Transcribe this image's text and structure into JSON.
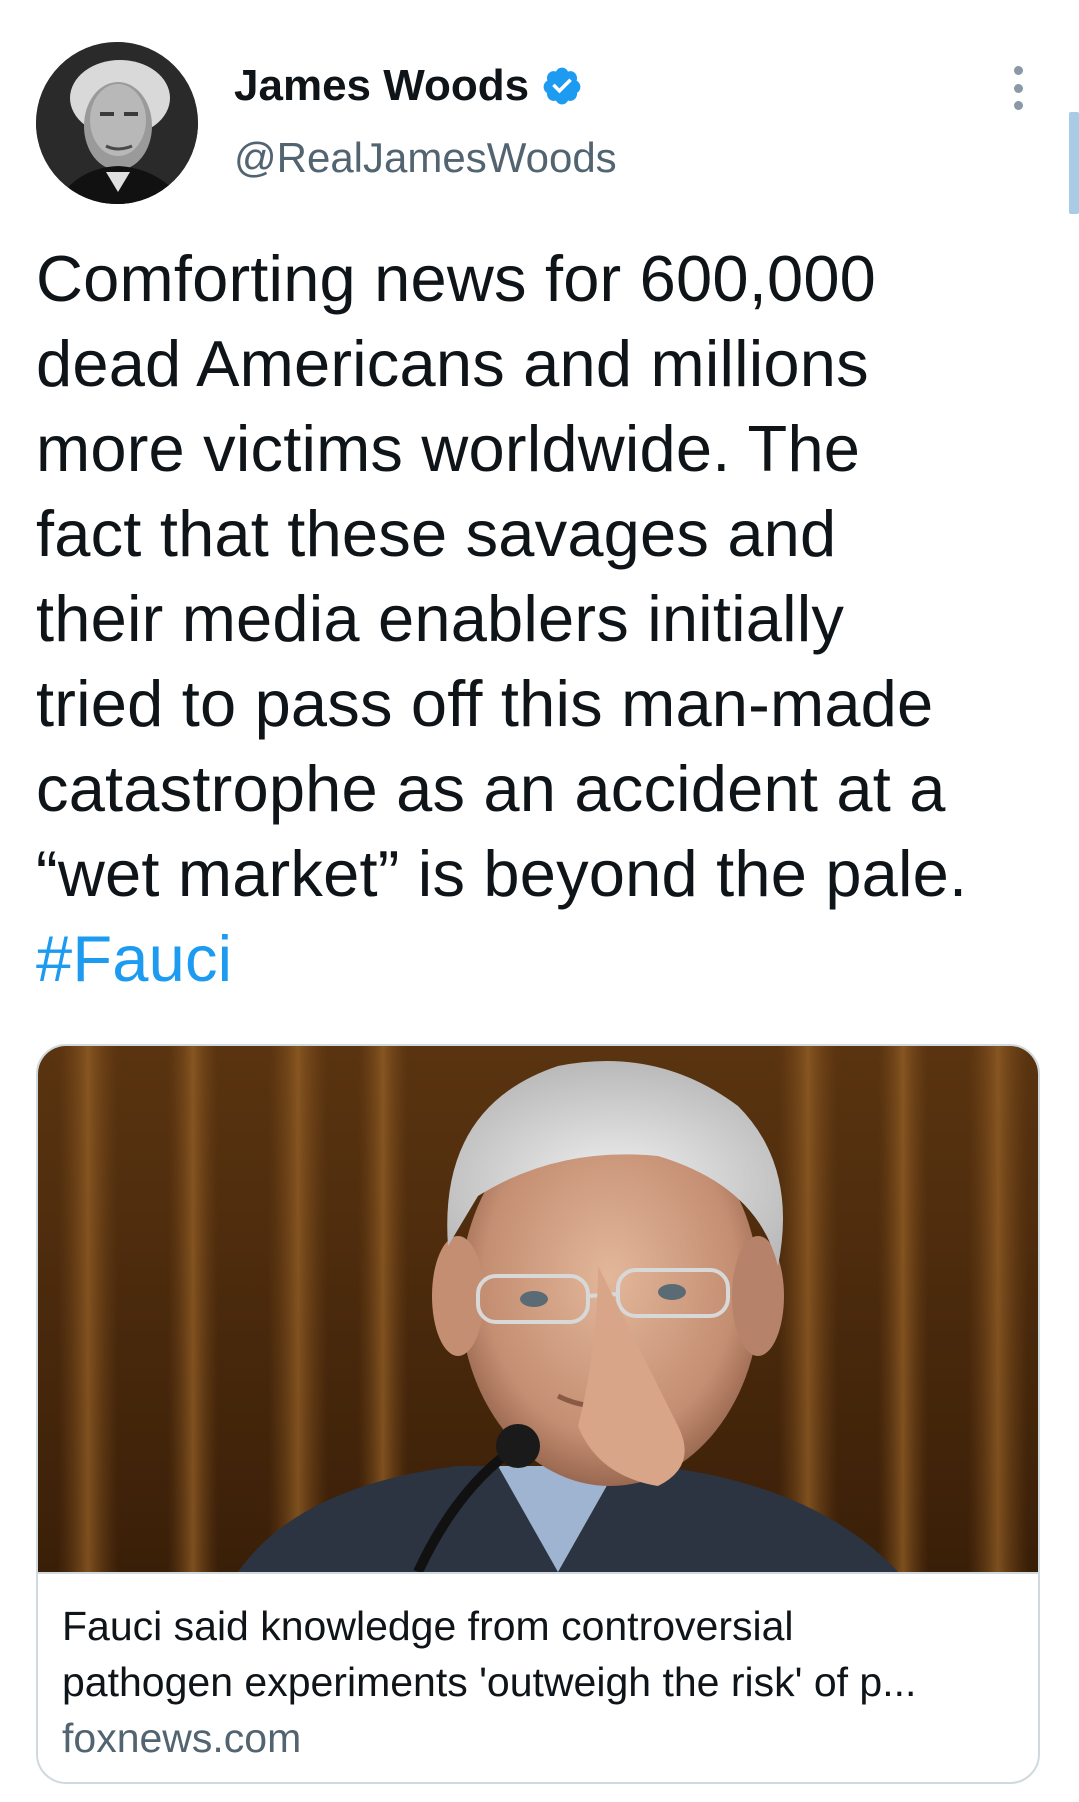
{
  "author": {
    "display_name": "James Woods",
    "handle": "@RealJamesWoods",
    "verified": true,
    "avatar_icon": "profile-photo"
  },
  "tweet": {
    "lines": [
      "Comforting news for 600,000",
      "dead Americans and millions",
      "more victims worldwide. The",
      "fact that these savages and",
      "their media enablers initially",
      "tried to pass off this man-made",
      "catastrophe as an accident at a",
      "“wet market” is beyond the pale."
    ],
    "hashtag": "#Fauci"
  },
  "link_card": {
    "title_lines": [
      "Fauci said knowledge from controversial",
      "pathogen experiments 'outweigh the risk' of p..."
    ],
    "domain": "foxnews.com",
    "image_icon": "article-photo"
  },
  "colors": {
    "text": "#0f1419",
    "secondary": "#536471",
    "accent": "#1d9bf0",
    "border": "#cfd9de"
  }
}
